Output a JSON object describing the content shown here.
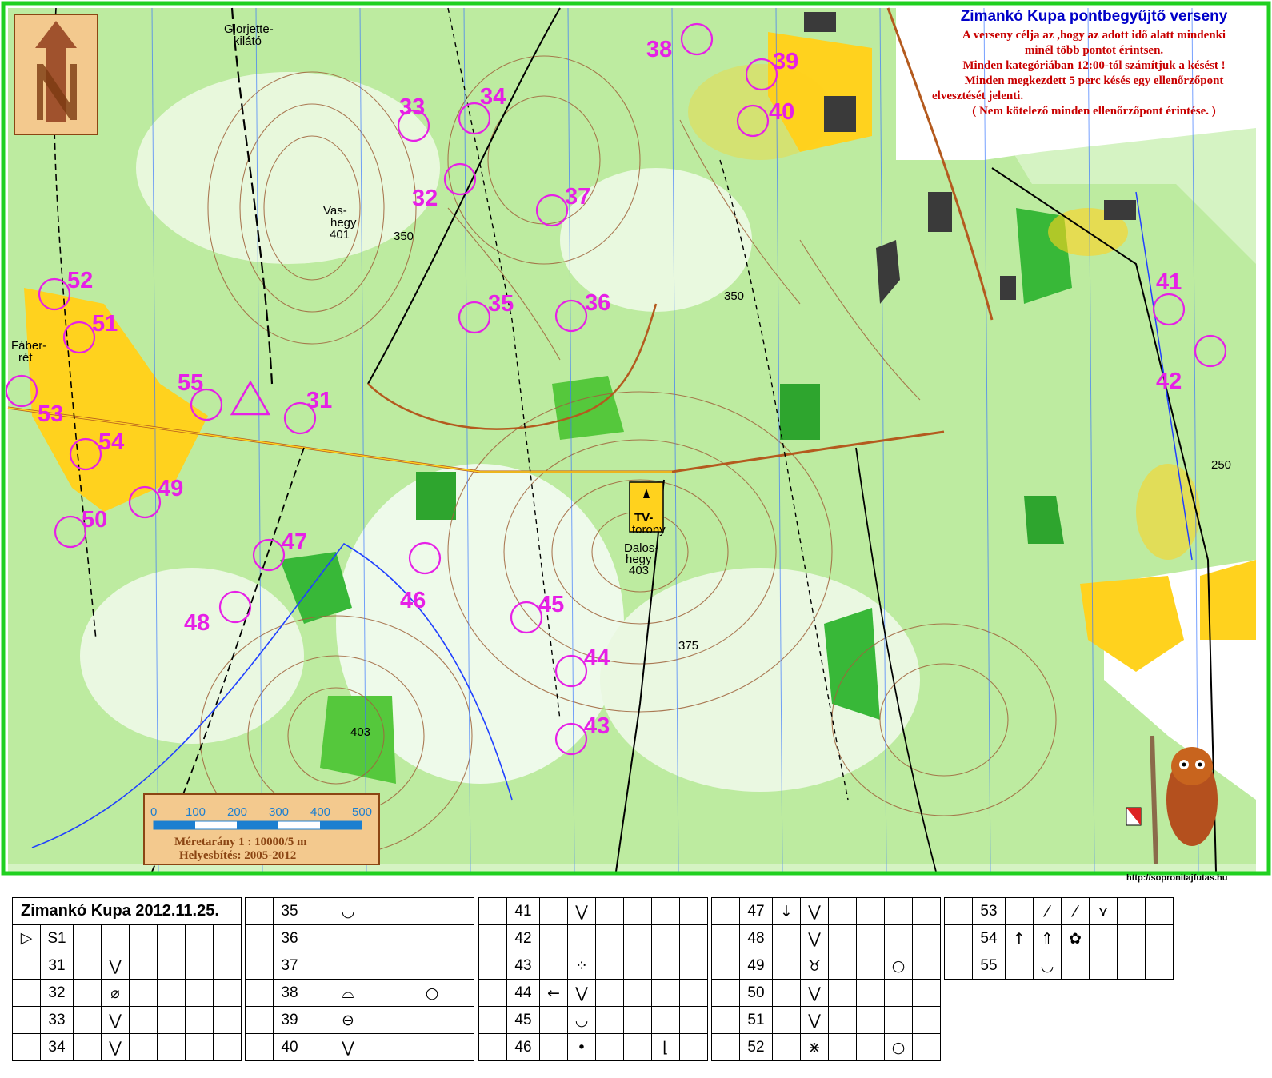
{
  "title": {
    "heading": "Zimankó Kupa pontbegyűjtő verseny",
    "lines": [
      "A verseny célja az ,hogy az adott idő alatt mindenki",
      "minél több pontot érintsen.",
      "Minden kategóriában 12:00-tól számítjuk a késést !",
      "Minden megkezdett 5 perc késés egy ellenőrzőpont",
      "elvesztését jelenti.",
      "( Nem kötelező minden ellenőrzőpont érintése. )"
    ]
  },
  "places": {
    "glorietta": "Glorjette-",
    "glorietta2": "kilátó",
    "vashegy": "Vas-",
    "vashegy2": "hegy",
    "vashegy_h": "401",
    "faber": "Fáber-",
    "faber2": "rét",
    "tv": "TV-",
    "tv2": "torony",
    "dalos": "Dalos-",
    "dalos2": "hegy",
    "dalos_h": "403",
    "h403": "403",
    "c350a": "350",
    "c350b": "350",
    "c375": "375",
    "c250": "250"
  },
  "scale": {
    "ticks": [
      "0",
      "100",
      "200",
      "300",
      "400",
      "500"
    ],
    "ratio": "Méretarány  1 : 10000/5 m",
    "update": "Helyesbítés: 2005-2012"
  },
  "url": "http://sopronitajfutas.hu",
  "controls": [
    {
      "n": "31"
    },
    {
      "n": "32"
    },
    {
      "n": "33"
    },
    {
      "n": "34"
    },
    {
      "n": "35"
    },
    {
      "n": "36"
    },
    {
      "n": "37"
    },
    {
      "n": "38"
    },
    {
      "n": "39"
    },
    {
      "n": "40"
    },
    {
      "n": "41"
    },
    {
      "n": "42"
    },
    {
      "n": "43"
    },
    {
      "n": "44"
    },
    {
      "n": "45"
    },
    {
      "n": "46"
    },
    {
      "n": "47"
    },
    {
      "n": "48"
    },
    {
      "n": "49"
    },
    {
      "n": "50"
    },
    {
      "n": "51"
    },
    {
      "n": "52"
    },
    {
      "n": "53"
    },
    {
      "n": "54"
    },
    {
      "n": "55"
    }
  ],
  "description_sheet": {
    "heading": "Zimankó Kupa 2012.11.25.",
    "start_code": "S1",
    "start_symbol": "▷",
    "columns": [
      [
        {
          "code": "31",
          "c3": "",
          "c4": "⋁",
          "c5": "",
          "c6": "",
          "c7": "",
          "c8": ""
        },
        {
          "code": "32",
          "c3": "",
          "c4": "⌀",
          "c5": "",
          "c6": "",
          "c7": "",
          "c8": ""
        },
        {
          "code": "33",
          "c3": "",
          "c4": "⋁",
          "c5": "",
          "c6": "",
          "c7": "",
          "c8": ""
        },
        {
          "code": "34",
          "c3": "",
          "c4": "⋁",
          "c5": "",
          "c6": "",
          "c7": "",
          "c8": ""
        }
      ],
      [
        {
          "code": "35",
          "c3": "",
          "c4": "◡",
          "c5": "",
          "c6": "",
          "c7": "",
          "c8": ""
        },
        {
          "code": "36",
          "c3": "",
          "c4": "",
          "c5": "",
          "c6": "",
          "c7": "",
          "c8": ""
        },
        {
          "code": "37",
          "c3": "",
          "c4": "",
          "c5": "",
          "c6": "",
          "c7": "",
          "c8": ""
        },
        {
          "code": "38",
          "c3": "",
          "c4": "⌓",
          "c5": "",
          "c6": "",
          "c7": "○",
          "c8": ""
        },
        {
          "code": "39",
          "c3": "",
          "c4": "⊖",
          "c5": "",
          "c6": "",
          "c7": "",
          "c8": ""
        },
        {
          "code": "40",
          "c3": "",
          "c4": "⋁",
          "c5": "",
          "c6": "",
          "c7": "",
          "c8": ""
        }
      ],
      [
        {
          "code": "41",
          "c3": "",
          "c4": "⋁",
          "c5": "",
          "c6": "",
          "c7": "",
          "c8": ""
        },
        {
          "code": "42",
          "c3": "",
          "c4": "",
          "c5": "",
          "c6": "",
          "c7": "",
          "c8": ""
        },
        {
          "code": "43",
          "c3": "",
          "c4": "⁘",
          "c5": "",
          "c6": "",
          "c7": "",
          "c8": ""
        },
        {
          "code": "44",
          "c3": "←",
          "c4": "⋁",
          "c5": "",
          "c6": "",
          "c7": "",
          "c8": ""
        },
        {
          "code": "45",
          "c3": "",
          "c4": "◡",
          "c5": "",
          "c6": "",
          "c7": "",
          "c8": ""
        },
        {
          "code": "46",
          "c3": "",
          "c4": "•",
          "c5": "",
          "c6": "",
          "c7": "⌊",
          "c8": ""
        }
      ],
      [
        {
          "code": "47",
          "c3": "↓",
          "c4": "⋁",
          "c5": "",
          "c6": "",
          "c7": "",
          "c8": ""
        },
        {
          "code": "48",
          "c3": "",
          "c4": "⋁",
          "c5": "",
          "c6": "",
          "c7": "",
          "c8": ""
        },
        {
          "code": "49",
          "c3": "",
          "c4": "♉",
          "c5": "",
          "c6": "",
          "c7": "○",
          "c8": ""
        },
        {
          "code": "50",
          "c3": "",
          "c4": "⋁",
          "c5": "",
          "c6": "",
          "c7": "",
          "c8": ""
        },
        {
          "code": "51",
          "c3": "",
          "c4": "⋁",
          "c5": "",
          "c6": "",
          "c7": "",
          "c8": ""
        },
        {
          "code": "52",
          "c3": "",
          "c4": "⋇",
          "c5": "",
          "c6": "",
          "c7": "○",
          "c8": ""
        }
      ],
      [
        {
          "code": "53",
          "c3": "",
          "c4": "⁄",
          "c5": "⁄",
          "c6": "⋎",
          "c7": "",
          "c8": ""
        },
        {
          "code": "54",
          "c3": "↑",
          "c4": "⇑",
          "c5": "✿",
          "c6": "",
          "c7": "",
          "c8": ""
        },
        {
          "code": "55",
          "c3": "",
          "c4": "◡",
          "c5": "",
          "c6": "",
          "c7": "",
          "c8": ""
        }
      ]
    ]
  },
  "colors": {
    "forest_light": "#b9eb9d",
    "forest_mid": "#55c83c",
    "forest_dark": "#2ea52e",
    "open": "#ffd21e",
    "contour": "#a0643c",
    "magenta": "#e620e6",
    "border": "#20d020",
    "blue": "#3c78ff"
  }
}
